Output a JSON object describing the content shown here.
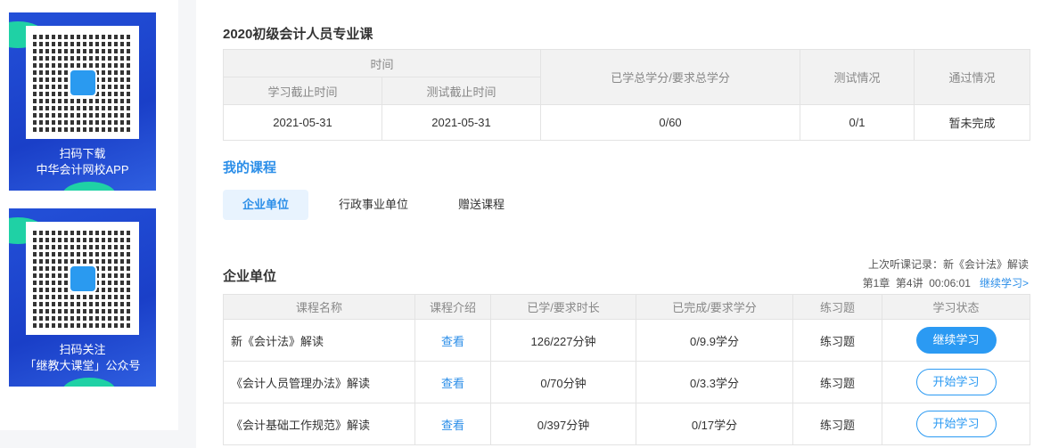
{
  "sidebar": {
    "promos": [
      {
        "line1": "扫码下载",
        "line2": "中华会计网校APP"
      },
      {
        "line1": "扫码关注",
        "line2": "「继教大课堂」公众号"
      }
    ]
  },
  "summary": {
    "title": "2020初级会计人员专业课",
    "headers": {
      "time": "时间",
      "study_deadline": "学习截止时间",
      "test_deadline": "测试截止时间",
      "credits": "已学总学分/要求总学分",
      "test": "测试情况",
      "pass": "通过情况"
    },
    "row": {
      "study_deadline": "2021-05-31",
      "test_deadline": "2021-05-31",
      "credits": "0/60",
      "test": "0/1",
      "pass": "暂未完成"
    }
  },
  "my_courses": {
    "title": "我的课程",
    "tabs": [
      "企业单位",
      "行政事业单位",
      "赠送课程"
    ]
  },
  "section": {
    "title": "企业单位",
    "last_record_label": "上次听课记录：新《会计法》解读",
    "last_position": "第1章  第4讲  00:06:01",
    "continue_link": "继续学习>",
    "headers": [
      "课程名称",
      "课程介绍",
      "已学/要求时长",
      "已完成/要求学分",
      "练习题",
      "学习状态"
    ],
    "rows": [
      {
        "name": "新《会计法》解读",
        "intro": "查看",
        "duration": "126/227分钟",
        "credits": "0/9.9学分",
        "practice": "练习题",
        "action": "继续学习"
      },
      {
        "name": "《会计人员管理办法》解读",
        "intro": "查看",
        "duration": "0/70分钟",
        "credits": "0/3.3学分",
        "practice": "练习题",
        "action": "开始学习"
      },
      {
        "name": "《会计基础工作规范》解读",
        "intro": "查看",
        "duration": "0/397分钟",
        "credits": "0/17学分",
        "practice": "练习题",
        "action": "开始学习"
      }
    ]
  }
}
